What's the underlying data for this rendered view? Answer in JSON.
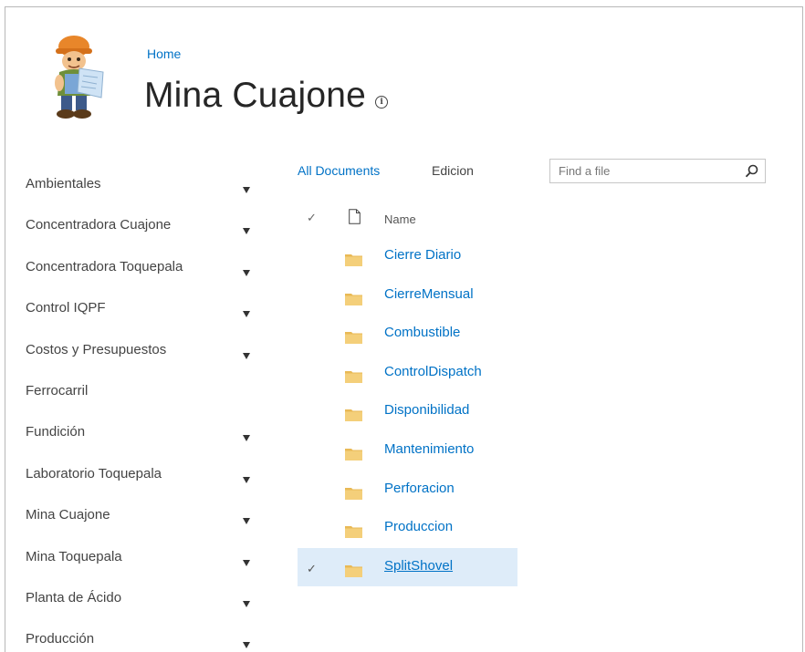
{
  "header": {
    "breadcrumb_home": "Home",
    "site_title": "Mina Cuajone",
    "info_glyph": "i"
  },
  "nav": {
    "items": [
      {
        "label": "Ambientales",
        "expandable": true
      },
      {
        "label": "Concentradora Cuajone",
        "expandable": true
      },
      {
        "label": "Concentradora Toquepala",
        "expandable": true
      },
      {
        "label": "Control IQPF",
        "expandable": true
      },
      {
        "label": "Costos y Presupuestos",
        "expandable": true
      },
      {
        "label": "Ferrocarril",
        "expandable": false
      },
      {
        "label": "Fundición",
        "expandable": true
      },
      {
        "label": "Laboratorio Toquepala",
        "expandable": true
      },
      {
        "label": "Mina Cuajone",
        "expandable": true
      },
      {
        "label": "Mina Toquepala",
        "expandable": true
      },
      {
        "label": "Planta de Ácido",
        "expandable": true
      },
      {
        "label": "Producción",
        "expandable": true
      }
    ]
  },
  "views": {
    "all_documents": "All Documents",
    "edicion": "Edicion"
  },
  "search": {
    "placeholder": "Find a file",
    "value": ""
  },
  "list": {
    "header_check": "✓",
    "column_name": "Name",
    "rows": [
      {
        "name": "Cierre Diario",
        "selected": false
      },
      {
        "name": "CierreMensual",
        "selected": false
      },
      {
        "name": "Combustible",
        "selected": false
      },
      {
        "name": "ControlDispatch",
        "selected": false
      },
      {
        "name": "Disponibilidad",
        "selected": false
      },
      {
        "name": "Mantenimiento",
        "selected": false
      },
      {
        "name": "Perforacion",
        "selected": false
      },
      {
        "name": "Produccion",
        "selected": false
      },
      {
        "name": "SplitShovel",
        "selected": true
      }
    ]
  },
  "colors": {
    "link": "#0072c6",
    "selected_row": "#deecf9",
    "folder": "#f4cf7a"
  }
}
